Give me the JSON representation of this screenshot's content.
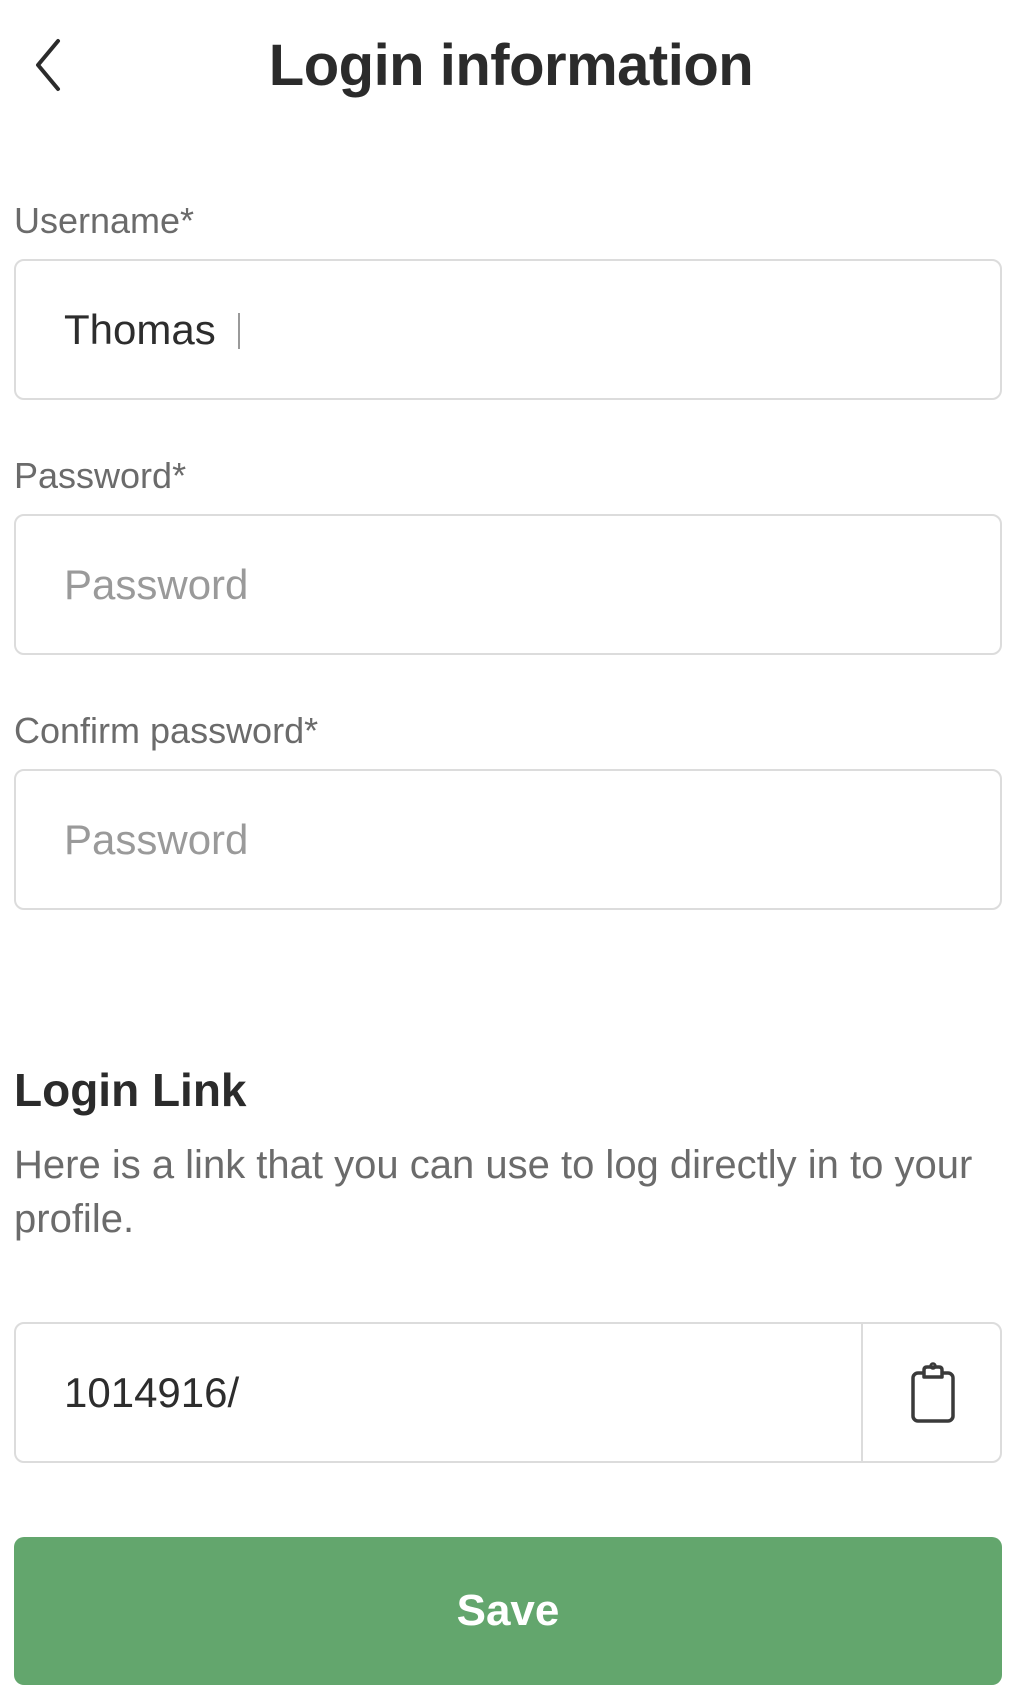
{
  "header": {
    "title": "Login information",
    "back_icon": "chevron-left-icon"
  },
  "form": {
    "username": {
      "label": "Username*",
      "value": "Thomas"
    },
    "password": {
      "label": "Password*",
      "placeholder": "Password",
      "value": ""
    },
    "confirm_password": {
      "label": "Confirm password*",
      "placeholder": "Password",
      "value": ""
    }
  },
  "login_link": {
    "heading": "Login Link",
    "description": "Here is a link that you can use to log directly in to your profile.",
    "value": "1014916/",
    "copy_icon": "clipboard-icon"
  },
  "save": {
    "label": "Save"
  },
  "colors": {
    "primary_button": "#63a66d",
    "border": "#dcdcdc",
    "label_text": "#6b6b6b",
    "placeholder_text": "#9a9a9a"
  }
}
